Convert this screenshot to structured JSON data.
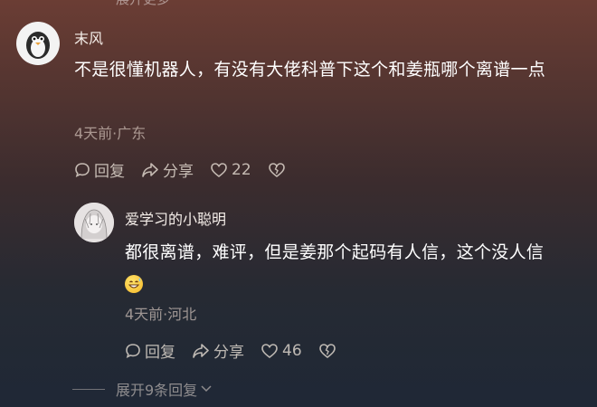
{
  "top_partial_text": "展开更多",
  "comment1": {
    "username": "末风",
    "text": "不是很懂机器人，有没有大佬科普下这个和姜瓶哪个离谱一点",
    "meta": "4天前·广东",
    "reply_label": "回复",
    "share_label": "分享",
    "like_count": "22",
    "icons": [
      "comment-icon",
      "share-icon",
      "heart-icon",
      "dislike-icon"
    ]
  },
  "reply1": {
    "username": "爱学习的小聪明",
    "text": "都很离谱，难评，但是姜那个起码有人信，这个没人信",
    "emoji": "grinning-sweat-emoji",
    "meta": "4天前·河北",
    "reply_label": "回复",
    "share_label": "分享",
    "like_count": "46",
    "icons": [
      "comment-icon",
      "share-icon",
      "heart-icon",
      "dislike-icon"
    ]
  },
  "expand": {
    "label": "展开9条回复"
  },
  "colors": {
    "text": "#ffffff",
    "meta": "#c9b9ae",
    "bg_top": "#6b3d34",
    "bg_bottom": "#1f2836"
  }
}
